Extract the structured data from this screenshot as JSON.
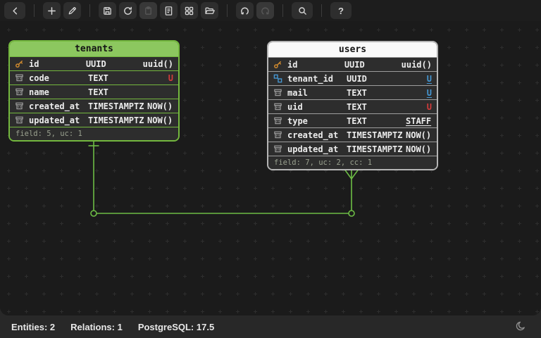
{
  "toolbar": {
    "icons": [
      "back",
      "add",
      "edit-pen",
      "save",
      "reload",
      "copy-clipboard",
      "export-document",
      "grid-layout",
      "open-folder",
      "undo",
      "redo",
      "search",
      "help"
    ],
    "help_label": "?",
    "disabled_buttons": [
      "copy-clipboard",
      "redo"
    ]
  },
  "colors": {
    "accent_green": "#8cc75f",
    "relation_green": "#6dbd45",
    "unique_red": "#d23b3b",
    "unique_blue": "#4596d1",
    "canvas_bg": "#1b1b1b"
  },
  "tables": [
    {
      "title": "tenants",
      "footer": "field: 5, uc: 1",
      "fields": [
        {
          "name": "id",
          "type": "UUID",
          "extra": "uuid()"
        },
        {
          "name": "code",
          "type": "TEXT",
          "extra": "U"
        },
        {
          "name": "name",
          "type": "TEXT",
          "extra": ""
        },
        {
          "name": "created_at",
          "type": "TIMESTAMPTZ",
          "extra": "NOW()"
        },
        {
          "name": "updated_at",
          "type": "TIMESTAMPTZ",
          "extra": "NOW()"
        }
      ]
    },
    {
      "title": "users",
      "footer": "field: 7, uc: 2, cc: 1",
      "fields": [
        {
          "name": "id",
          "type": "UUID",
          "extra": "uuid()"
        },
        {
          "name": "tenant_id",
          "type": "UUID",
          "extra": "U"
        },
        {
          "name": "mail",
          "type": "TEXT",
          "extra": "U"
        },
        {
          "name": "uid",
          "type": "TEXT",
          "extra": "U"
        },
        {
          "name": "type",
          "type": "TEXT",
          "extra": "STAFF"
        },
        {
          "name": "created_at",
          "type": "TIMESTAMPTZ",
          "extra": "NOW()"
        },
        {
          "name": "updated_at",
          "type": "TIMESTAMPTZ",
          "extra": "NOW()"
        }
      ]
    }
  ],
  "relation": {
    "from": "tenants",
    "to": "users",
    "cardinality": "one-to-many"
  },
  "statusbar": {
    "entities": "Entities: 2",
    "relations": "Relations: 1",
    "dialect": "PostgreSQL: 17.5"
  }
}
